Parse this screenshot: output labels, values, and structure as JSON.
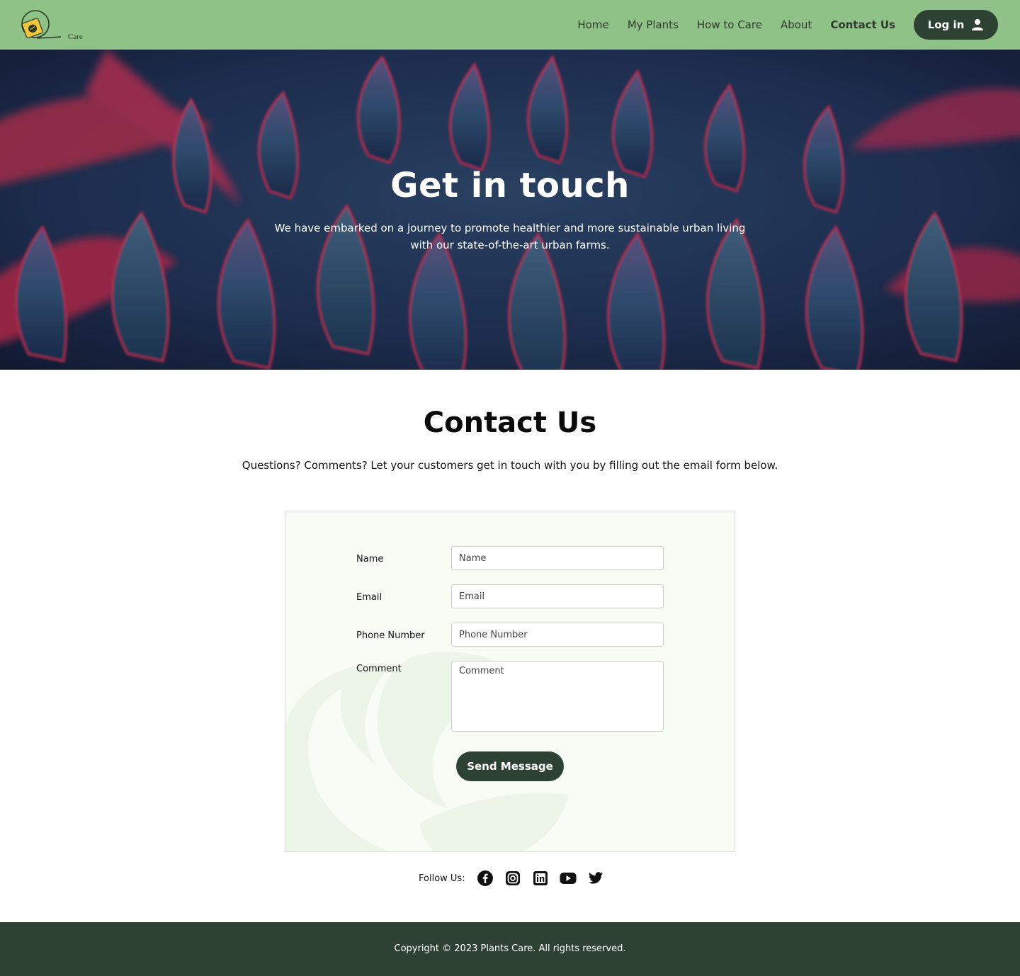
{
  "nav": {
    "logo_text": "Care",
    "links": [
      {
        "label": "Home"
      },
      {
        "label": "My Plants"
      },
      {
        "label": "How to Care"
      },
      {
        "label": "About"
      },
      {
        "label": "Contact Us",
        "active": true
      }
    ],
    "login_label": "Log in"
  },
  "hero": {
    "title": "Get in touch",
    "subtitle": "We have embarked on a journey to promote healthier and more sustainable urban living with our state-of-the-art urban farms."
  },
  "contact": {
    "title": "Contact Us",
    "subtitle": "Questions? Comments? Let your customers get in touch with you by filling out the email form below."
  },
  "form": {
    "name_label": "Name",
    "name_placeholder": "Name",
    "email_label": "Email",
    "email_placeholder": "Email",
    "phone_label": "Phone Number",
    "phone_placeholder": "Phone Number",
    "comment_label": "Comment",
    "comment_placeholder": "Comment",
    "submit_label": "Send Message"
  },
  "follow": {
    "label": "Follow Us:",
    "icons": [
      "facebook-icon",
      "instagram-icon",
      "linkedin-icon",
      "youtube-icon",
      "twitter-icon"
    ]
  },
  "footer": {
    "copyright": "Copyright © 2023 Plants Care. All rights reserved."
  },
  "colors": {
    "nav_bg": "#8fc287",
    "dark_green": "#2e4234",
    "form_bg": "#f7fdf5",
    "hero_blue": "#1d2c4a",
    "hero_red": "#c8284a"
  }
}
